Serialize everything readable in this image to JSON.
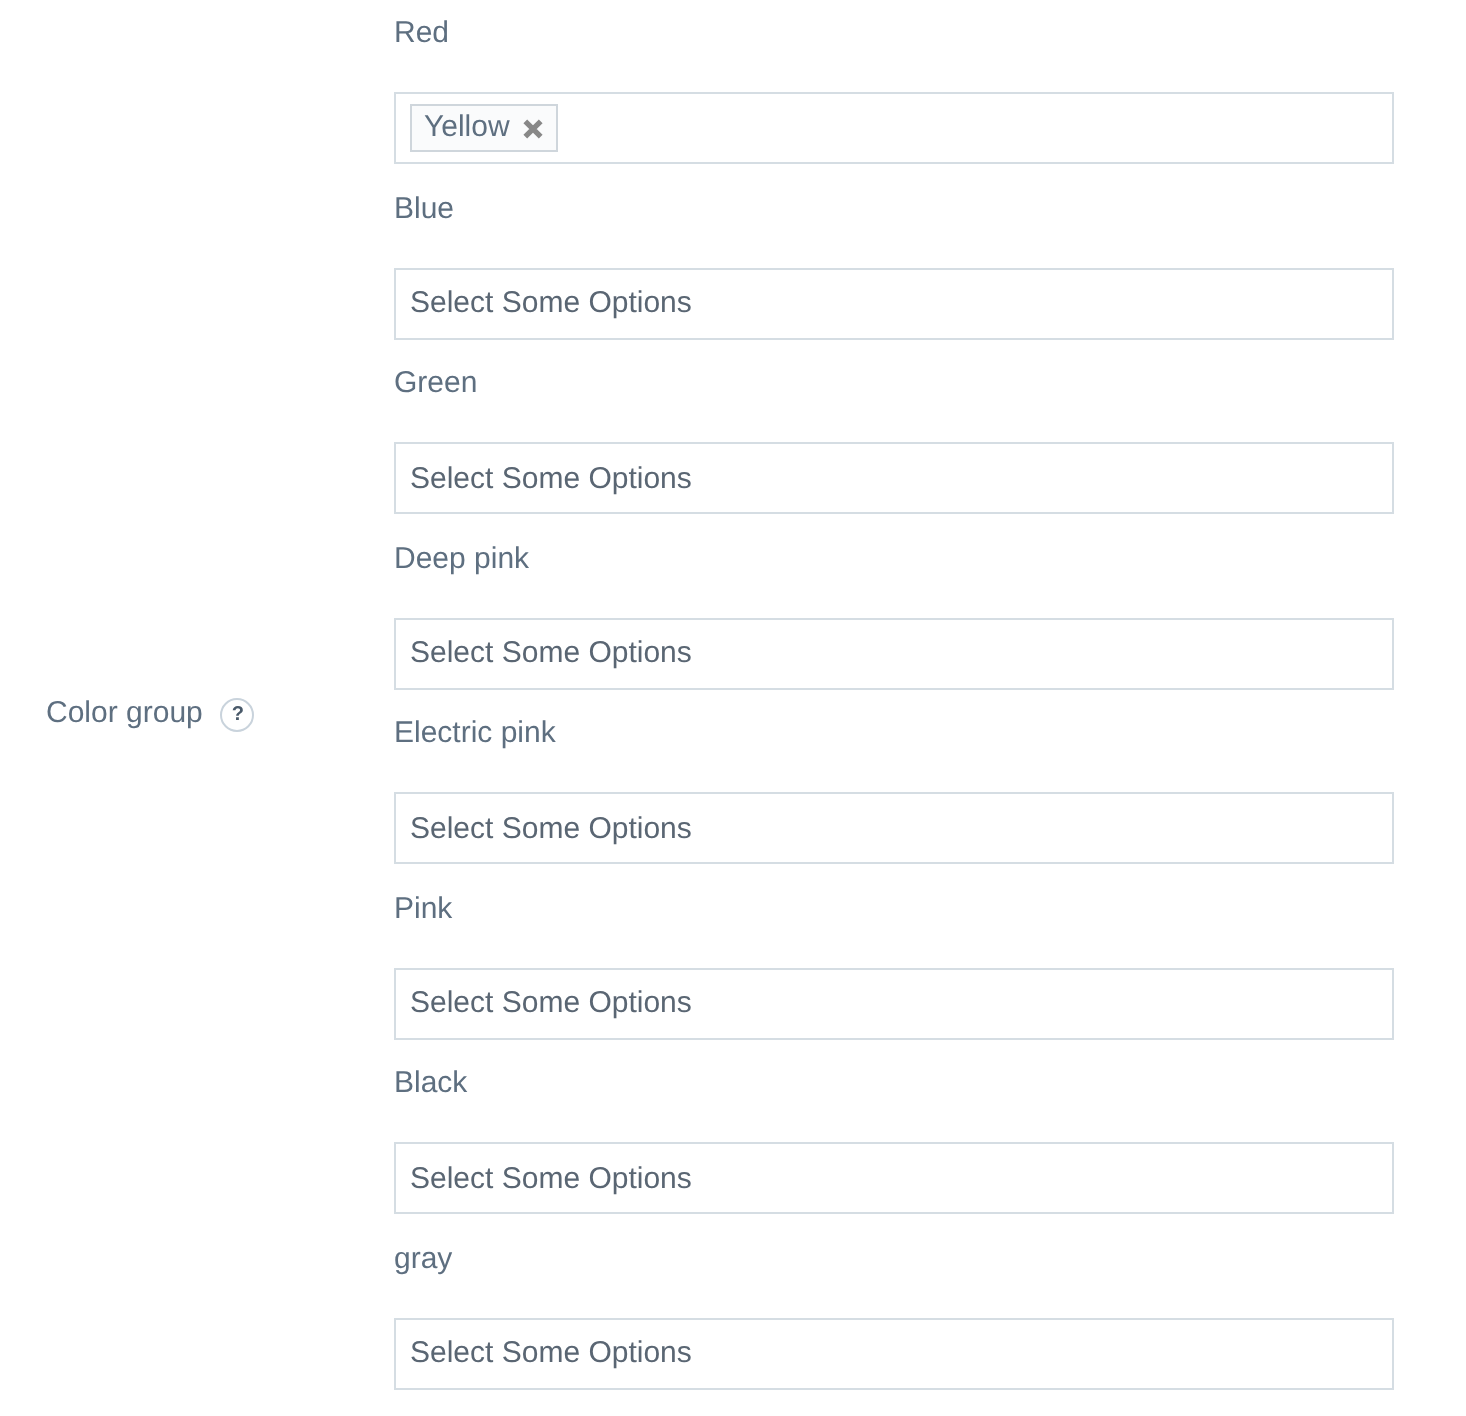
{
  "form_row": {
    "label": "Color group",
    "help_icon": "?",
    "fields": [
      {
        "label": "Red",
        "selected_options": [
          "Yellow"
        ]
      },
      {
        "label": "Blue",
        "placeholder": "Select Some Options"
      },
      {
        "label": "Green",
        "placeholder": "Select Some Options"
      },
      {
        "label": "Deep pink",
        "placeholder": "Select Some Options"
      },
      {
        "label": "Electric pink",
        "placeholder": "Select Some Options"
      },
      {
        "label": "Pink",
        "placeholder": "Select Some Options"
      },
      {
        "label": "Black",
        "placeholder": "Select Some Options"
      },
      {
        "label": "gray",
        "placeholder": "Select Some Options"
      }
    ]
  }
}
